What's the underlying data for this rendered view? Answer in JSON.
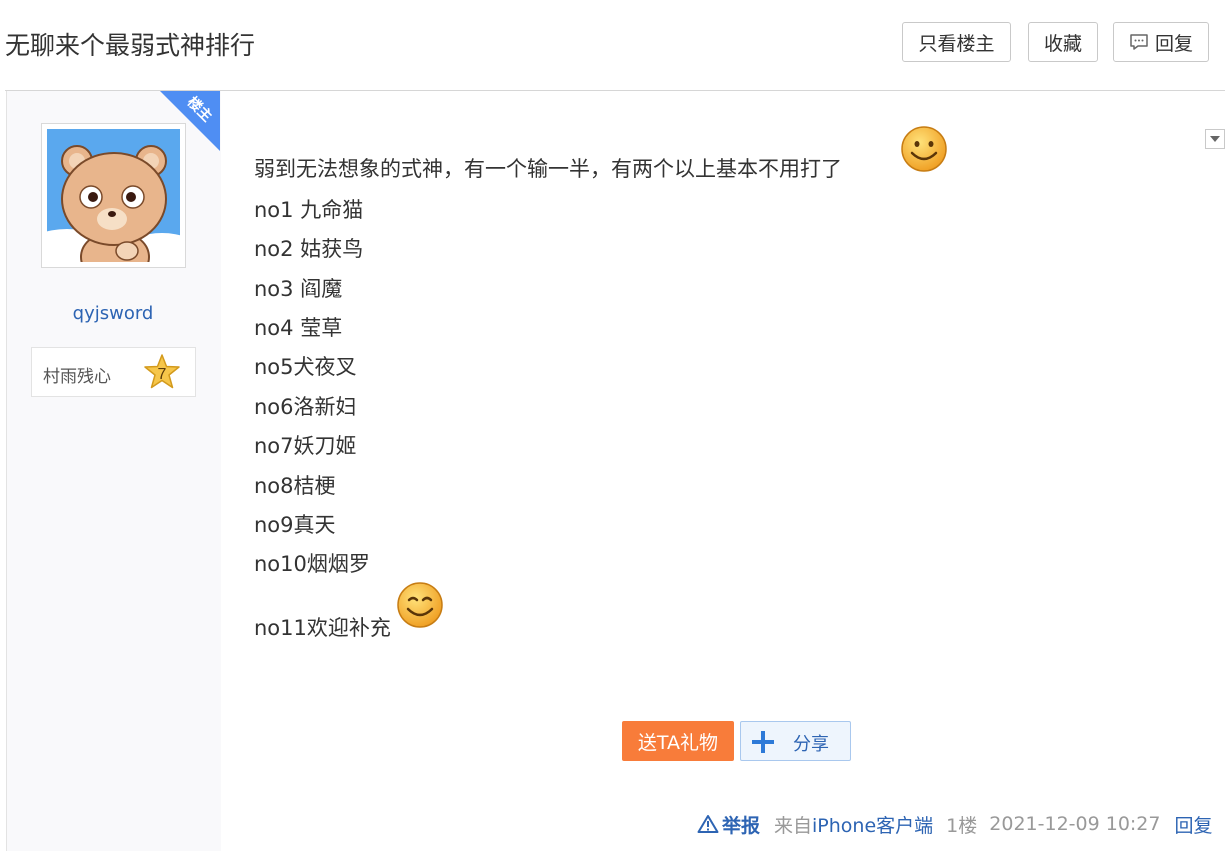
{
  "header": {
    "title": "无聊来个最弱式神排行",
    "buttons": {
      "only_op": "只看楼主",
      "favorite": "收藏",
      "reply": "回复"
    }
  },
  "sidebar": {
    "op_badge": "楼主",
    "username": "qyjsword",
    "title_name": "村雨残心",
    "level": "7"
  },
  "post": {
    "lines": [
      "弱到无法想象的式神，有一个输一半，有两个以上基本不用打了",
      "no1 九命猫",
      "no2 姑获鸟",
      "no3 阎魔",
      "no4 莹草",
      "no5犬夜叉",
      "no6洛新妇",
      "no7妖刀姬",
      "no8桔梗",
      "no9真天",
      "no10烟烟罗",
      "no11欢迎补充"
    ]
  },
  "actions": {
    "gift": "送TA礼物",
    "share": "分享"
  },
  "footer": {
    "report": "举报",
    "source_prefix": "来自",
    "source_client": "iPhone客户端",
    "floor": "1楼",
    "timestamp": "2021-12-09 10:27",
    "reply": "回复"
  },
  "icons": {
    "comment": "comment-icon",
    "warning": "warning-icon",
    "smiley": "smiley-icon",
    "plus": "plus-icon",
    "star": "level-star-icon",
    "dropdown": "chevron-down-icon"
  },
  "colors": {
    "link_blue": "#2d64b3",
    "gift_orange": "#f87c3a",
    "op_corner_blue": "#4f8ef3",
    "sidebar_bg": "#f9f9fb"
  }
}
